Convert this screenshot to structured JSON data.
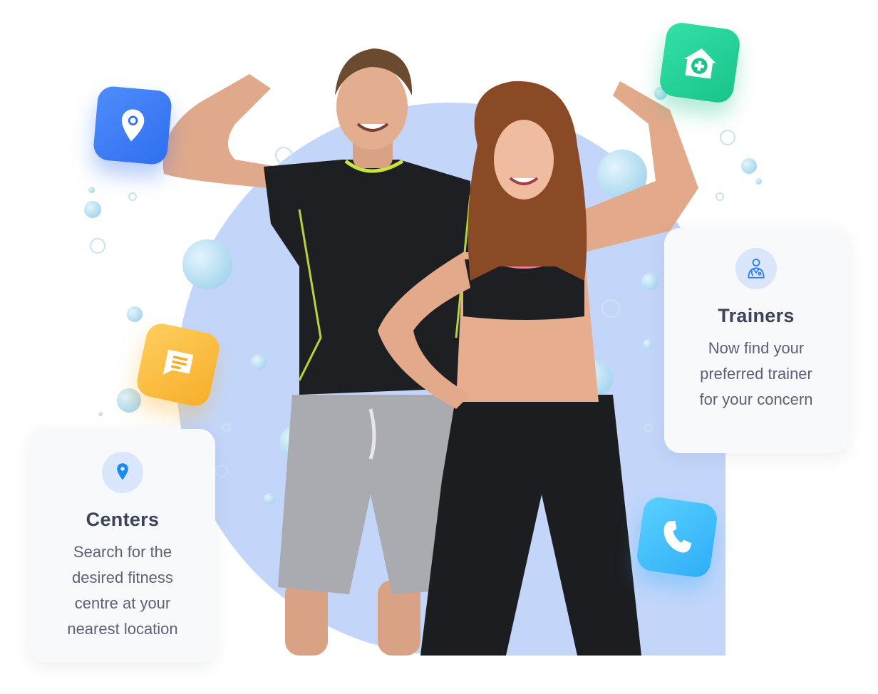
{
  "colors": {
    "backdrop": "#c3d6fa",
    "location_tile": "#2f6ef0",
    "clinic_tile": "#19c48a",
    "chat_tile": "#f6ae28",
    "phone_tile": "#2eaef8",
    "card_title": "#3b4459",
    "card_text": "#5b6275"
  },
  "tiles": [
    {
      "icon": "map-pin-icon"
    },
    {
      "icon": "clinic-house-icon"
    },
    {
      "icon": "chat-message-icon"
    },
    {
      "icon": "phone-icon"
    }
  ],
  "trainers_card": {
    "icon": "trainer-icon",
    "title": "Trainers",
    "lines": [
      "Now find your",
      "preferred trainer",
      "for your concern"
    ]
  },
  "centers_card": {
    "icon": "location-pin-icon",
    "title": "Centers",
    "lines": [
      "Search for the",
      "desired fitness",
      "centre at your",
      "nearest location"
    ]
  }
}
